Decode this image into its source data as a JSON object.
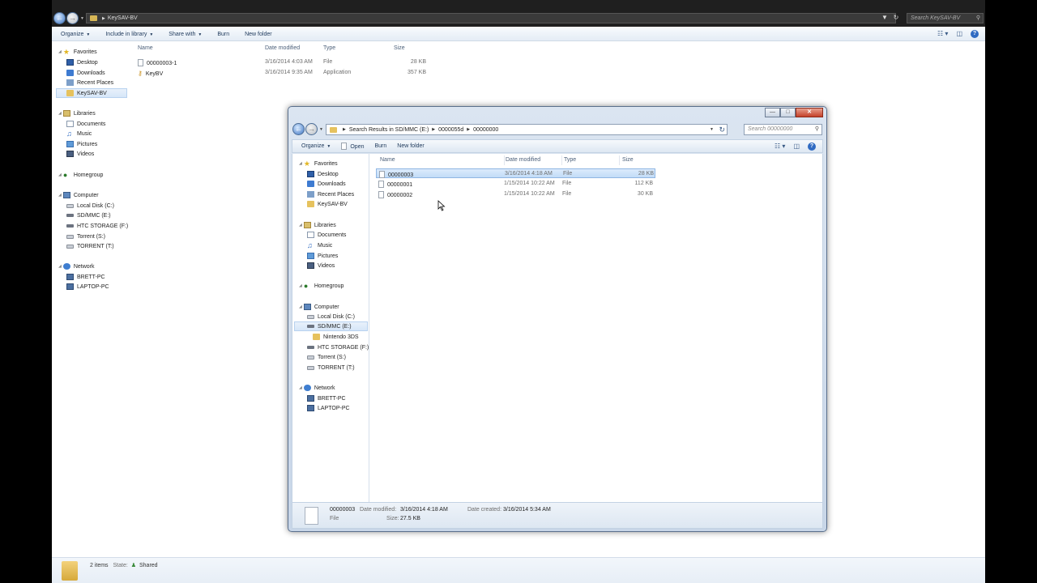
{
  "background_window": {
    "address": {
      "crumb": "KeySAV-BV"
    },
    "search_placeholder": "Search KeySAV-BV",
    "toolbar": {
      "organize": "Organize",
      "include_in_library": "Include in library",
      "share_with": "Share with",
      "burn": "Burn",
      "new_folder": "New folder"
    },
    "nav": {
      "favorites": "Favorites",
      "desktop": "Desktop",
      "downloads": "Downloads",
      "recent_places": "Recent Places",
      "keysav": "KeySAV-BV",
      "libraries": "Libraries",
      "documents": "Documents",
      "music": "Music",
      "pictures": "Pictures",
      "videos": "Videos",
      "homegroup": "Homegroup",
      "computer": "Computer",
      "local_disk": "Local Disk (C:)",
      "sd_mmc": "SD/MMC (E:)",
      "htc_storage": "HTC STORAGE (F:)",
      "torrent_s": "Torrent (S:)",
      "torrent_t": "TORRENT (T:)",
      "network": "Network",
      "brett_pc": "BRETT-PC",
      "laptop_pc": "LAPTOP-PC"
    },
    "columns": {
      "name": "Name",
      "date": "Date modified",
      "type": "Type",
      "size": "Size"
    },
    "files": [
      {
        "name": "00000003-1",
        "date": "3/16/2014 4:03 AM",
        "type": "File",
        "size": "28 KB"
      },
      {
        "name": "KeyBV",
        "date": "3/16/2014 9:35 AM",
        "type": "Application",
        "size": "357 KB"
      }
    ],
    "status": {
      "count": "2 items",
      "state_label": "State:",
      "state_value": "Shared"
    }
  },
  "foreground_window": {
    "address": {
      "crumb1": "Search Results in SD/MMC (E:)",
      "crumb2": "0000055d",
      "crumb3": "00000000"
    },
    "search_placeholder": "Search 00000000",
    "toolbar": {
      "organize": "Organize",
      "open": "Open",
      "burn": "Burn",
      "new_folder": "New folder"
    },
    "nav": {
      "favorites": "Favorites",
      "desktop": "Desktop",
      "downloads": "Downloads",
      "recent_places": "Recent Places",
      "keysav": "KeySAV-BV",
      "libraries": "Libraries",
      "documents": "Documents",
      "music": "Music",
      "pictures": "Pictures",
      "videos": "Videos",
      "homegroup": "Homegroup",
      "computer": "Computer",
      "local_disk": "Local Disk (C:)",
      "sd_mmc": "SD/MMC (E:)",
      "nintendo": "Nintendo 3DS",
      "htc_storage": "HTC STORAGE (F:)",
      "torrent_s": "Torrent (S:)",
      "torrent_t": "TORRENT (T:)",
      "network": "Network",
      "brett_pc": "BRETT-PC",
      "laptop_pc": "LAPTOP-PC"
    },
    "columns": {
      "name": "Name",
      "date": "Date modified",
      "type": "Type",
      "size": "Size"
    },
    "files": [
      {
        "name": "00000003",
        "date": "3/16/2014 4:18 AM",
        "type": "File",
        "size": "28 KB"
      },
      {
        "name": "00000001",
        "date": "1/15/2014 10:22 AM",
        "type": "File",
        "size": "112 KB"
      },
      {
        "name": "00000002",
        "date": "1/15/2014 10:22 AM",
        "type": "File",
        "size": "30 KB"
      }
    ],
    "details": {
      "name": "00000003",
      "kind": "File",
      "modified_label": "Date modified:",
      "modified_value": "3/16/2014 4:18 AM",
      "size_label": "Size:",
      "size_value": "27.5 KB",
      "created_label": "Date created:",
      "created_value": "3/16/2014 5:34 AM"
    }
  },
  "colors": {
    "selection": "#c2dcf7",
    "toolbar_text": "#1e395b",
    "close_button": "#c4412a"
  }
}
